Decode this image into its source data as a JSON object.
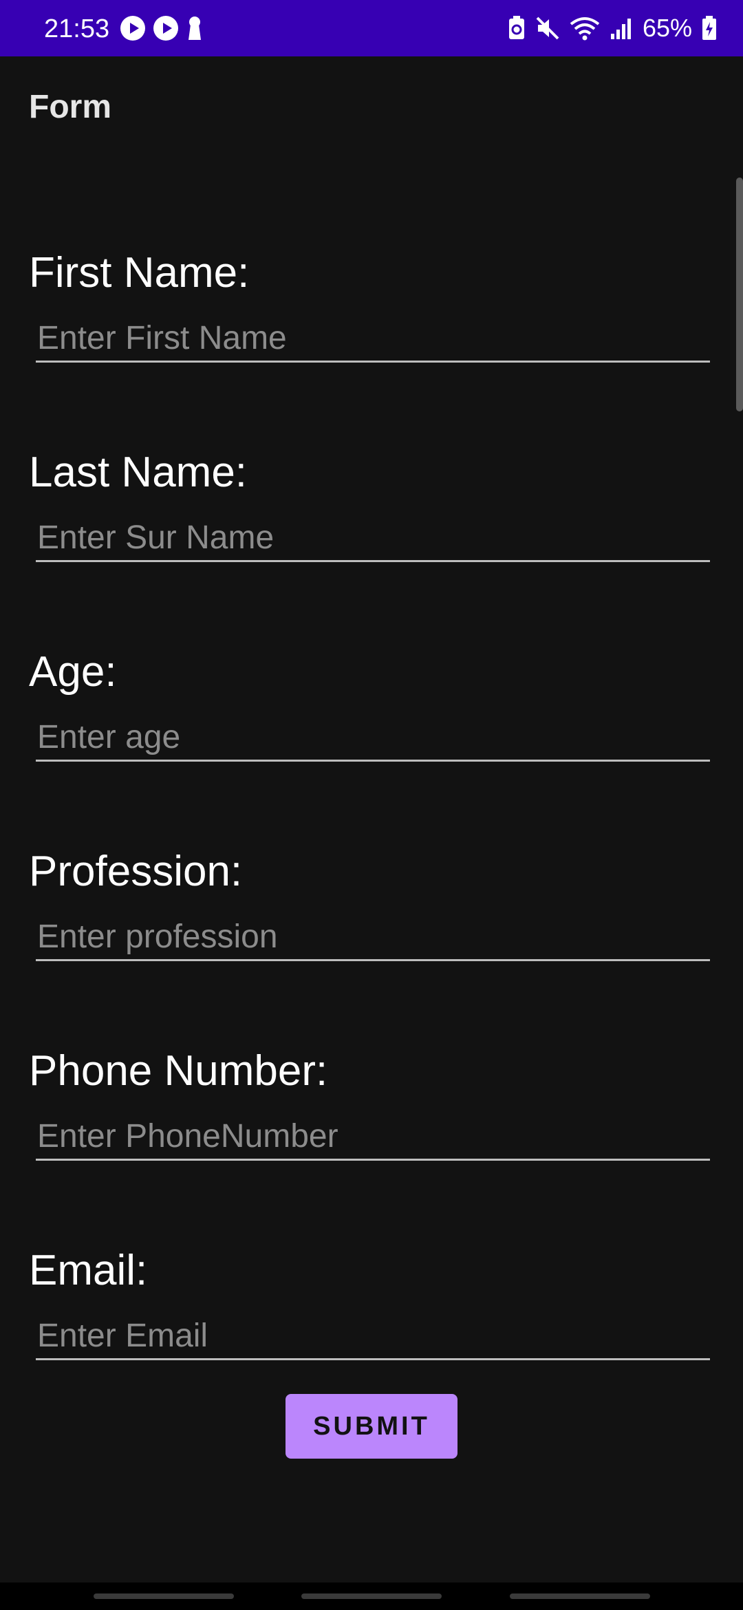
{
  "status_bar": {
    "time": "21:53",
    "battery_percent": "65%",
    "icons": [
      "play-circle-icon",
      "play-circle-icon",
      "keyhole-icon",
      "battery-saver-icon",
      "mute-icon",
      "wifi-icon",
      "signal-icon",
      "battery-icon"
    ],
    "background": "#3700b3"
  },
  "app_bar": {
    "title": "Form"
  },
  "form": {
    "fields": [
      {
        "label": "First Name:",
        "placeholder": "Enter First Name",
        "value": ""
      },
      {
        "label": "Last Name:",
        "placeholder": "Enter Sur Name",
        "value": ""
      },
      {
        "label": "Age:",
        "placeholder": "Enter age",
        "value": ""
      },
      {
        "label": "Profession:",
        "placeholder": "Enter profession",
        "value": ""
      },
      {
        "label": "Phone Number:",
        "placeholder": "Enter PhoneNumber",
        "value": ""
      },
      {
        "label": "Email:",
        "placeholder": "Enter Email",
        "value": ""
      }
    ],
    "submit_label": "SUBMIT",
    "accent": "#bb86fc"
  },
  "nav_bar": {
    "handles": [
      "nav-handle",
      "nav-handle",
      "nav-handle"
    ]
  }
}
